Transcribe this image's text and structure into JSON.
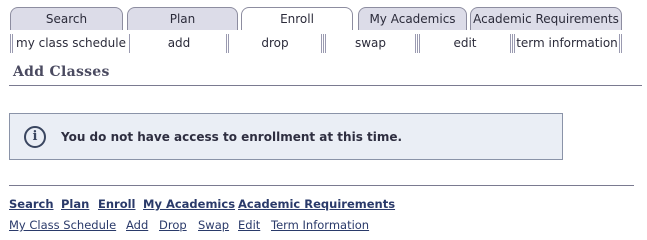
{
  "tabs": [
    {
      "label": "Search",
      "active": false
    },
    {
      "label": "Plan",
      "active": false
    },
    {
      "label": "Enroll",
      "active": true
    },
    {
      "label": "My Academics",
      "active": false
    },
    {
      "label": "Academic Requirements",
      "active": false
    }
  ],
  "subnav": [
    {
      "label": "my class schedule",
      "active": false
    },
    {
      "label": "add",
      "active": true
    },
    {
      "label": "drop",
      "active": false
    },
    {
      "label": "swap",
      "active": false
    },
    {
      "label": "edit",
      "active": false
    },
    {
      "label": "term information",
      "active": false
    }
  ],
  "page": {
    "title": "Add Classes"
  },
  "alert": {
    "icon": "info-icon",
    "icon_glyph": "i",
    "message": "You do not have access to enrollment at this time."
  },
  "footer": {
    "main_links": [
      "Search",
      "Plan",
      "Enroll",
      "My Academics",
      "Academic Requirements"
    ],
    "sub_links": [
      "My Class Schedule",
      "Add",
      "Drop",
      "Swap",
      "Edit",
      "Term Information"
    ]
  }
}
